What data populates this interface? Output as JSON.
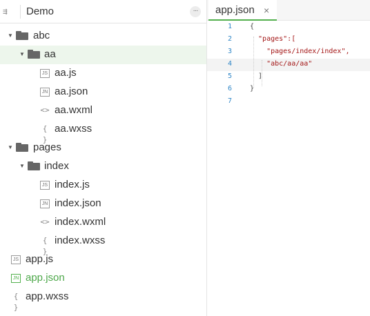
{
  "sidebar": {
    "toggle_glyph": "⇶",
    "title": "Demo",
    "more_glyph": "···",
    "tree": [
      {
        "label": "abc",
        "kind": "folder",
        "expanded": true
      },
      {
        "label": "aa",
        "kind": "folder",
        "expanded": true,
        "selected": true
      },
      {
        "label": "aa.js",
        "kind": "file",
        "icon": "js-file-icon",
        "badge": "JS"
      },
      {
        "label": "aa.json",
        "kind": "file",
        "icon": "json-file-icon",
        "badge": "JN"
      },
      {
        "label": "aa.wxml",
        "kind": "file",
        "icon": "wxml-file-icon",
        "glyph": "<>"
      },
      {
        "label": "aa.wxss",
        "kind": "file",
        "icon": "wxss-file-icon",
        "glyph": "{ }"
      },
      {
        "label": "pages",
        "kind": "folder",
        "expanded": true
      },
      {
        "label": "index",
        "kind": "folder",
        "expanded": true
      },
      {
        "label": "index.js",
        "kind": "file",
        "icon": "js-file-icon",
        "badge": "JS"
      },
      {
        "label": "index.json",
        "kind": "file",
        "icon": "json-file-icon",
        "badge": "JN"
      },
      {
        "label": "index.wxml",
        "kind": "file",
        "icon": "wxml-file-icon",
        "glyph": "<>"
      },
      {
        "label": "index.wxss",
        "kind": "file",
        "icon": "wxss-file-icon",
        "glyph": "{ }"
      },
      {
        "label": "app.js",
        "kind": "file",
        "icon": "js-file-icon",
        "badge": "JS"
      },
      {
        "label": "app.json",
        "kind": "file",
        "icon": "json-file-icon",
        "badge": "JN",
        "active": true
      },
      {
        "label": "app.wxss",
        "kind": "file",
        "icon": "wxss-file-icon",
        "glyph": "{ }"
      }
    ]
  },
  "editor": {
    "tab": {
      "name": "app.json",
      "close_glyph": "×"
    },
    "lines": [
      {
        "num": "1",
        "text": "{"
      },
      {
        "num": "2",
        "text": "  \"pages\":["
      },
      {
        "num": "3",
        "text": "    \"pages/index/index\","
      },
      {
        "num": "4",
        "text": "    \"abc/aa/aa\""
      },
      {
        "num": "5",
        "text": "  ]"
      },
      {
        "num": "6",
        "text": "}"
      },
      {
        "num": "7",
        "text": ""
      }
    ]
  },
  "colors": {
    "accent": "#52b04d",
    "selected_row": "#edf6ec",
    "line_number": "#2f86c7",
    "string": "#a31515"
  }
}
